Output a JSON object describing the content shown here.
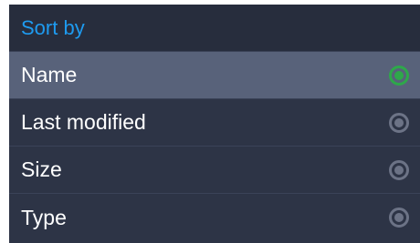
{
  "dialog": {
    "title": "Sort by",
    "options": [
      {
        "label": "Name",
        "selected": true
      },
      {
        "label": "Last modified",
        "selected": false
      },
      {
        "label": "Size",
        "selected": false
      },
      {
        "label": "Type",
        "selected": false
      }
    ]
  },
  "colors": {
    "title": "#1e9bf0",
    "selected_row": "#58627a",
    "radio_checked": "#2ea84a",
    "radio_unchecked": "#6c7386",
    "background": "#2d3446"
  }
}
